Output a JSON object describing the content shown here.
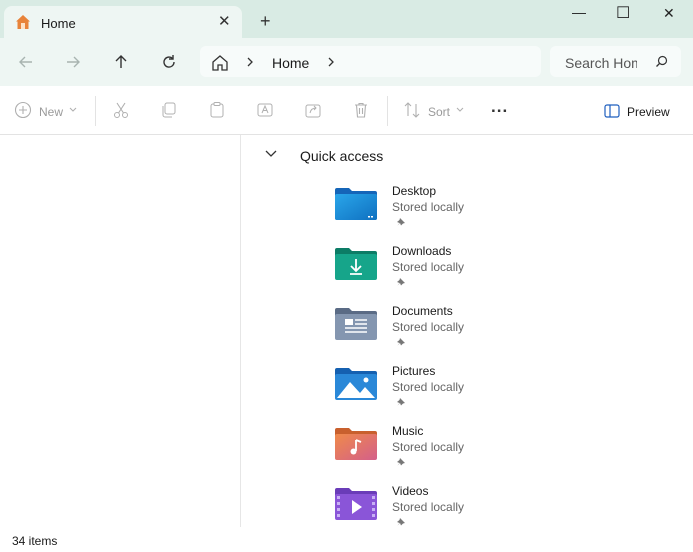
{
  "window": {
    "tab_title": "Home",
    "tab_close": "✕",
    "new_tab": "+",
    "minimize": "—",
    "maximize": "☐",
    "close": "✕"
  },
  "address": {
    "crumbs": [
      "Home"
    ],
    "search_placeholder": "Search Home"
  },
  "toolbar": {
    "new_label": "New",
    "sort_label": "Sort",
    "more_label": "...",
    "preview_label": "Preview"
  },
  "quick_access": {
    "title": "Quick access",
    "items": [
      {
        "name": "Desktop",
        "status": "Stored locally",
        "icon": "desktop-folder-icon",
        "color": "#1e8fd8"
      },
      {
        "name": "Downloads",
        "status": "Stored locally",
        "icon": "downloads-folder-icon",
        "color": "#16a58a"
      },
      {
        "name": "Documents",
        "status": "Stored locally",
        "icon": "documents-folder-icon",
        "color": "#7c8ea8"
      },
      {
        "name": "Pictures",
        "status": "Stored locally",
        "icon": "pictures-folder-icon",
        "color": "#2a88d8"
      },
      {
        "name": "Music",
        "status": "Stored locally",
        "icon": "music-folder-icon",
        "color": "#e0785a"
      },
      {
        "name": "Videos",
        "status": "Stored locally",
        "icon": "videos-folder-icon",
        "color": "#8a55d8"
      }
    ]
  },
  "status_bar": {
    "item_count": "34 items"
  }
}
